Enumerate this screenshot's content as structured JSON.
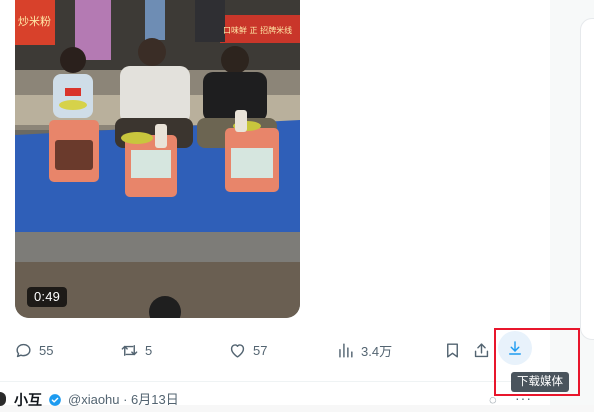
{
  "video": {
    "duration": "0:49",
    "sign_text_left": "炒米粉",
    "sign_text_right": "口味鲜 正 招牌米线"
  },
  "actions": {
    "reply_count": "55",
    "retweet_count": "5",
    "like_count": "57",
    "view_count": "3.4万",
    "icons": [
      "comment-icon",
      "retweet-icon",
      "heart-icon",
      "views-icon",
      "bookmark-icon",
      "share-icon",
      "download-icon"
    ]
  },
  "tooltip": {
    "download_label": "下载媒体"
  },
  "next_tweet": {
    "name": "小互",
    "handle_date": "@xiaohu · 6月13日"
  },
  "colors": {
    "accent": "#1d9bf0",
    "highlight": "#e8162c",
    "muted": "#536471"
  }
}
